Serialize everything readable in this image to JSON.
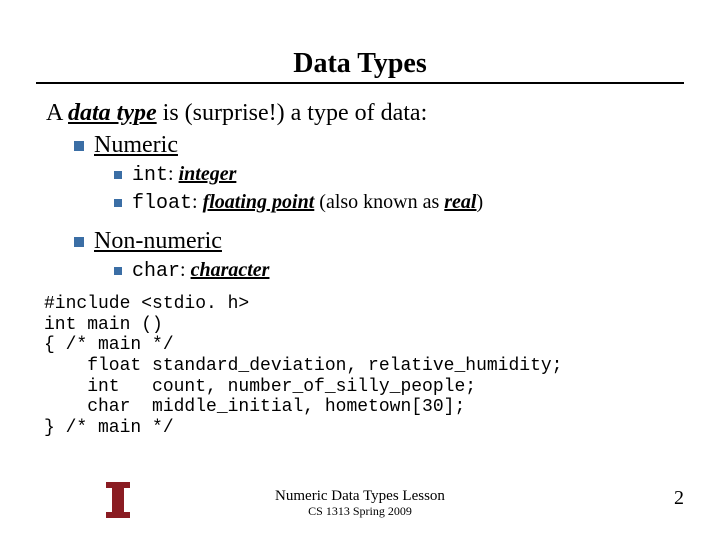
{
  "title": "Data Types",
  "intro": {
    "pre": "A ",
    "term": "data type",
    "post": " is (surprise!) a type of data:"
  },
  "sections": {
    "numeric": {
      "label": "Numeric",
      "items": {
        "int": {
          "kw": "int",
          "pre": ": ",
          "term": "integer",
          "post": ""
        },
        "float": {
          "kw": "float",
          "pre": ": ",
          "term": "floating point",
          "post": " (also known as ",
          "term2": "real",
          "post2": ")"
        }
      }
    },
    "nonnumeric": {
      "label": "Non-numeric",
      "items": {
        "char": {
          "kw": "char",
          "pre": ": ",
          "term": "character"
        }
      }
    }
  },
  "code": "#include <stdio. h>\nint main ()\n{ /* main */\n    float standard_deviation, relative_humidity;\n    int   count, number_of_silly_people;\n    char  middle_initial, hometown[30];\n} /* main */",
  "footer": {
    "lesson": "Numeric Data Types Lesson",
    "course": "CS 1313 Spring 2009"
  },
  "page": "2"
}
